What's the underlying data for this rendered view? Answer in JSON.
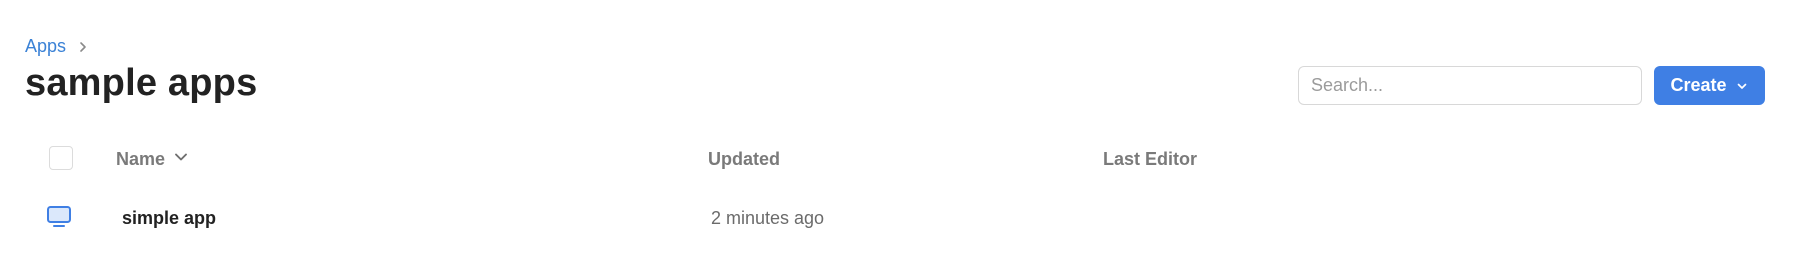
{
  "breadcrumb": {
    "root_label": "Apps"
  },
  "page": {
    "title": "sample apps"
  },
  "search": {
    "placeholder": "Search...",
    "value": ""
  },
  "toolbar": {
    "create_label": "Create"
  },
  "table": {
    "columns": {
      "name": "Name",
      "updated": "Updated",
      "last_editor": "Last Editor"
    },
    "sort": {
      "column": "Name",
      "direction": "descending"
    },
    "rows": [
      {
        "icon": "monitor-icon",
        "name": "simple app",
        "updated": "2 minutes ago",
        "last_editor": ""
      }
    ]
  },
  "colors": {
    "accent": "#3f7fe4",
    "link": "#3b82d6",
    "icon": "#3f7fe4"
  }
}
